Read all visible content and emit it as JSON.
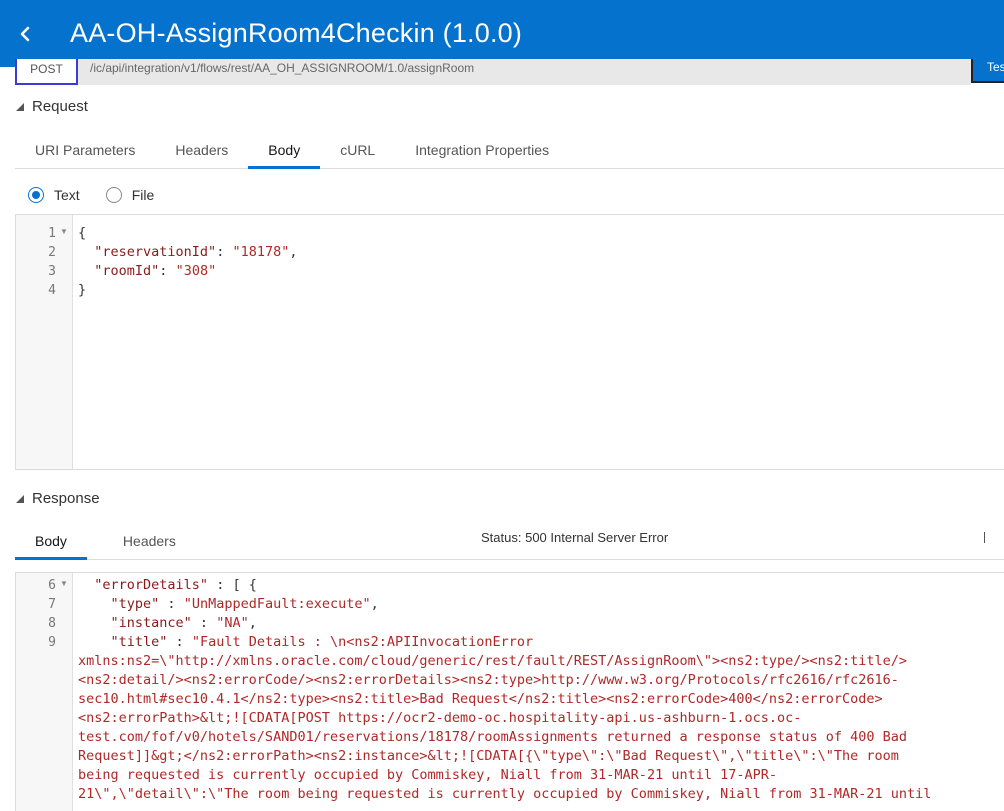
{
  "header": {
    "title": "AA-OH-AssignRoom4Checkin (1.0.0)"
  },
  "endpoint": {
    "method": "POST",
    "url": "/ic/api/integration/v1/flows/rest/AA_OH_ASSIGNROOM/1.0/assignRoom",
    "test_label": "Test"
  },
  "request": {
    "heading": "Request",
    "tabs": [
      "URI Parameters",
      "Headers",
      "Body",
      "cURL",
      "Integration Properties"
    ],
    "active_tab": "Body",
    "body_type": {
      "text_label": "Text",
      "file_label": "File",
      "selected": "Text"
    },
    "line_numbers": [
      "1",
      "2",
      "3",
      "4"
    ],
    "code": {
      "open": "{",
      "l2_key": "\"reservationId\"",
      "l2_val": "\"18178\"",
      "l3_key": "\"roomId\"",
      "l3_val": "\"308\"",
      "close": "}"
    }
  },
  "response": {
    "heading": "Response",
    "tabs": [
      "Body",
      "Headers"
    ],
    "active_tab": "Body",
    "status_label": "Status:",
    "status_value": "500 Internal Server Error",
    "line_numbers": [
      "6",
      "7",
      "8",
      "9"
    ],
    "code": {
      "l6_key": "\"errorDetails\"",
      "l6_rest": " : [ {",
      "l7_key": "\"type\"",
      "l7_val": "\"UnMappedFault:execute\"",
      "l8_key": "\"instance\"",
      "l8_val": "\"NA\"",
      "l9_key": "\"title\"",
      "l9_val": "\"Fault Details : \\n<ns2:APIInvocationError",
      "wrap1": "xmlns:ns2=\\\"http://xmlns.oracle.com/cloud/generic/rest/fault/REST/AssignRoom\\\"><ns2:type/><ns2:title/>",
      "wrap2": "<ns2:detail/><ns2:errorCode/><ns2:errorDetails><ns2:type>http://www.w3.org/Protocols/rfc2616/rfc2616-",
      "wrap3": "sec10.html#sec10.4.1</ns2:type><ns2:title>Bad Request</ns2:title><ns2:errorCode>400</ns2:errorCode>",
      "wrap4": "<ns2:errorPath>&lt;![CDATA[POST https://ocr2-demo-oc.hospitality-api.us-ashburn-1.ocs.oc-",
      "wrap5": "test.com/fof/v0/hotels/SAND01/reservations/18178/roomAssignments returned a response status of 400 Bad",
      "wrap6": "Request]]&gt;</ns2:errorPath><ns2:instance>&lt;![CDATA[{\\\"type\\\":\\\"Bad Request\\\",\\\"title\\\":\\\"The room",
      "wrap7": "being requested is currently occupied by Commiskey, Niall from 31-MAR-21 until 17-APR-",
      "wrap8": "21\\\",\\\"detail\\\":\\\"The room being requested is currently occupied by Commiskey, Niall from 31-MAR-21 until"
    }
  }
}
